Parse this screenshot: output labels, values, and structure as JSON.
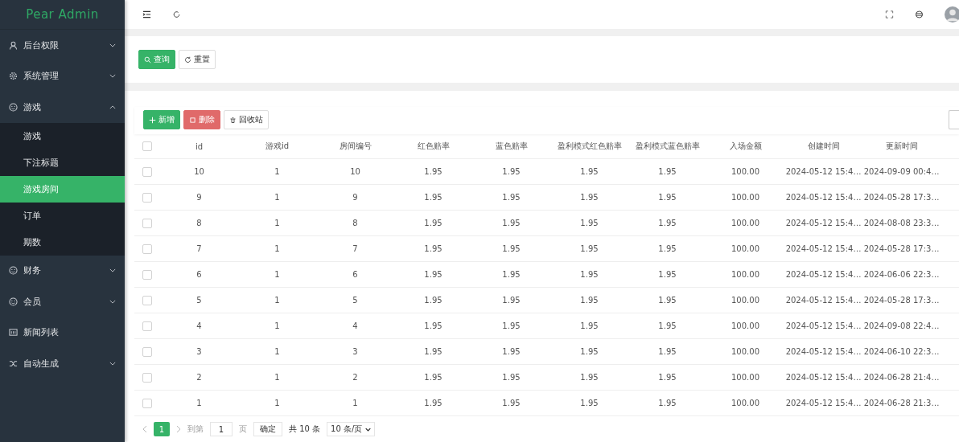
{
  "sidebar": {
    "logo": "Pear Admin",
    "menu": [
      {
        "label": "后台权限",
        "expanded": false
      },
      {
        "label": "系统管理",
        "expanded": false
      },
      {
        "label": "游戏",
        "expanded": true,
        "children": [
          {
            "label": "游戏",
            "selected": false
          },
          {
            "label": "下注标题",
            "selected": false
          },
          {
            "label": "游戏房间",
            "selected": true
          },
          {
            "label": "订单",
            "selected": false
          },
          {
            "label": "期数",
            "selected": false
          }
        ]
      },
      {
        "label": "财务",
        "expanded": false
      },
      {
        "label": "会员",
        "expanded": false
      },
      {
        "label": "新闻列表"
      },
      {
        "label": "自动生成",
        "expanded": false
      }
    ]
  },
  "search_buttons": [
    {
      "label": "查询",
      "kind": "primary"
    },
    {
      "label": "重置",
      "kind": "default"
    }
  ],
  "toolbar": [
    {
      "label": "新增",
      "kind": "primary"
    },
    {
      "label": "删除",
      "kind": "danger"
    },
    {
      "label": "回收站",
      "kind": "default"
    }
  ],
  "table": {
    "header_checked": false,
    "columns": [
      "id",
      "游戏id",
      "房间编号",
      "红色赔率",
      "蓝色赔率",
      "盈利模式红色赔率",
      "盈利模式蓝色赔率",
      "入场金额",
      "创建时间",
      "更新时间"
    ],
    "rows": [
      {
        "checked": false,
        "cells": [
          "10",
          "1",
          "10",
          "1.95",
          "1.95",
          "1.95",
          "1.95",
          "100.00",
          "2024-05-12 15:4…",
          "2024-09-09 00:4…"
        ]
      },
      {
        "checked": false,
        "cells": [
          "9",
          "1",
          "9",
          "1.95",
          "1.95",
          "1.95",
          "1.95",
          "100.00",
          "2024-05-12 15:4…",
          "2024-05-28 17:3…"
        ]
      },
      {
        "checked": false,
        "cells": [
          "8",
          "1",
          "8",
          "1.95",
          "1.95",
          "1.95",
          "1.95",
          "100.00",
          "2024-05-12 15:4…",
          "2024-08-08 23:3…"
        ]
      },
      {
        "checked": false,
        "cells": [
          "7",
          "1",
          "7",
          "1.95",
          "1.95",
          "1.95",
          "1.95",
          "100.00",
          "2024-05-12 15:4…",
          "2024-05-28 17:3…"
        ]
      },
      {
        "checked": false,
        "cells": [
          "6",
          "1",
          "6",
          "1.95",
          "1.95",
          "1.95",
          "1.95",
          "100.00",
          "2024-05-12 15:4…",
          "2024-06-06 22:3…"
        ]
      },
      {
        "checked": false,
        "cells": [
          "5",
          "1",
          "5",
          "1.95",
          "1.95",
          "1.95",
          "1.95",
          "100.00",
          "2024-05-12 15:4…",
          "2024-05-28 17:3…"
        ]
      },
      {
        "checked": false,
        "cells": [
          "4",
          "1",
          "4",
          "1.95",
          "1.95",
          "1.95",
          "1.95",
          "100.00",
          "2024-05-12 15:4…",
          "2024-09-08 22:4…"
        ]
      },
      {
        "checked": false,
        "cells": [
          "3",
          "1",
          "3",
          "1.95",
          "1.95",
          "1.95",
          "1.95",
          "100.00",
          "2024-05-12 15:4…",
          "2024-06-10 22:3…"
        ]
      },
      {
        "checked": false,
        "cells": [
          "2",
          "1",
          "2",
          "1.95",
          "1.95",
          "1.95",
          "1.95",
          "100.00",
          "2024-05-12 15:4…",
          "2024-06-28 21:4…"
        ]
      },
      {
        "checked": false,
        "cells": [
          "1",
          "1",
          "1",
          "1.95",
          "1.95",
          "1.95",
          "1.95",
          "100.00",
          "2024-05-12 15:4…",
          "2024-06-28 21:3…"
        ]
      }
    ]
  },
  "pagination": {
    "pages": [
      {
        "label": "1",
        "selected": true
      }
    ],
    "goto_label": "到第",
    "goto_value": "1",
    "page_unit": "页",
    "confirm": "确定",
    "total": "共 10 条",
    "page_size": "10 条/页"
  }
}
